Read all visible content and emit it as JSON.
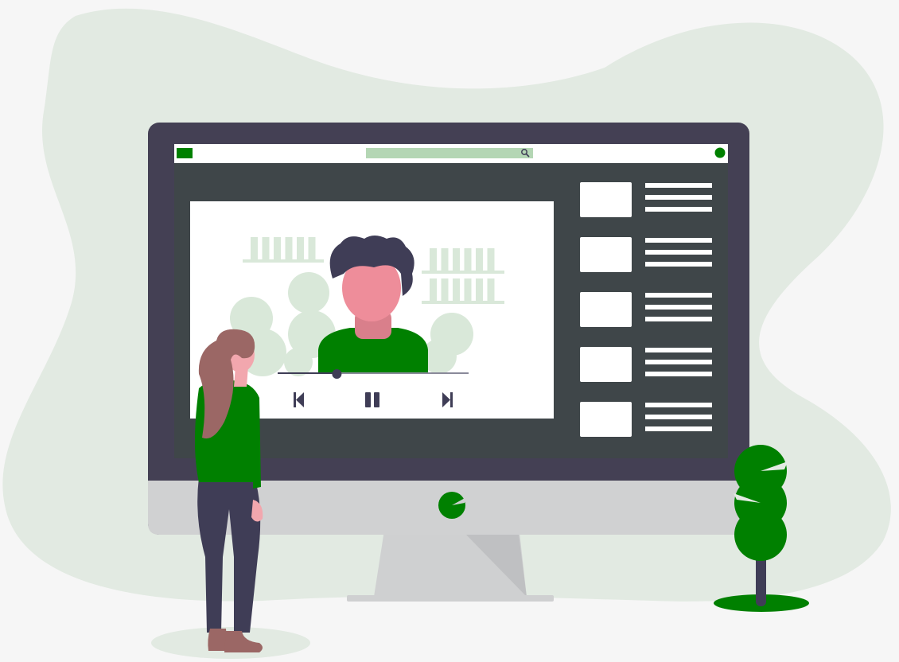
{
  "colors": {
    "background": "#f6f6f6",
    "blob": "#e2eae2",
    "monitor_frame": "#444054",
    "screen": "#3f4649",
    "chin": "#d0d1d2",
    "stand": "#cfd0d1",
    "accent_green": "#008000",
    "light_green": "#b4d6b4",
    "navy": "#3f3d56",
    "skin": "#ee8d9a",
    "hair_brown": "#9b6765",
    "white": "#ffffff"
  },
  "browser": {
    "logo_icon": "logo-block-icon",
    "search_icon": "magnifier-icon",
    "profile_icon": "profile-dot-icon"
  },
  "player": {
    "progress": 0.31,
    "controls": [
      "skip-back-icon",
      "pause-icon",
      "skip-forward-icon"
    ]
  },
  "playlist": {
    "item_count": 5,
    "lines_per_item": 3
  },
  "monitor": {
    "chin_logo_icon": "leaf-logo-icon"
  }
}
